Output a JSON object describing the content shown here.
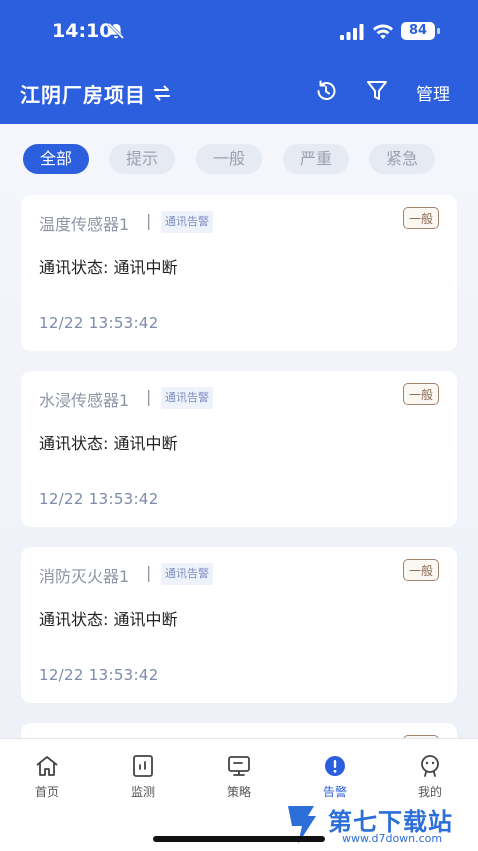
{
  "status_bar": {
    "time": "14:10",
    "battery": "84"
  },
  "header": {
    "project_title": "江阴厂房项目",
    "manage_label": "管理"
  },
  "filter_tabs": [
    {
      "label": "全部",
      "active": true
    },
    {
      "label": "提示",
      "active": false
    },
    {
      "label": "一般",
      "active": false
    },
    {
      "label": "严重",
      "active": false
    },
    {
      "label": "紧急",
      "active": false
    }
  ],
  "alarms": [
    {
      "device": "温度传感器1",
      "separator": "|",
      "type": "通讯告警",
      "level": "一般",
      "message": "通讯状态: 通讯中断",
      "time": "12/22 13:53:42"
    },
    {
      "device": "水浸传感器1",
      "separator": "|",
      "type": "通讯告警",
      "level": "一般",
      "message": "通讯状态: 通讯中断",
      "time": "12/22 13:53:42"
    },
    {
      "device": "消防灭火器1",
      "separator": "|",
      "type": "通讯告警",
      "level": "一般",
      "message": "通讯状态: 通讯中断",
      "time": "12/22 13:53:42"
    }
  ],
  "bottom_nav": [
    {
      "label": "首页",
      "icon": "home-icon",
      "active": false
    },
    {
      "label": "监测",
      "icon": "monitor-icon",
      "active": false
    },
    {
      "label": "策略",
      "icon": "strategy-icon",
      "active": false
    },
    {
      "label": "告警",
      "icon": "alarm-icon",
      "active": true
    },
    {
      "label": "我的",
      "icon": "profile-icon",
      "active": false
    }
  ],
  "watermark": {
    "title": "第七下载站",
    "url": "www.d7down.com"
  },
  "colors": {
    "primary": "#2c5fde",
    "badge_border": "#a5826c",
    "time_text": "#7d8aa8"
  }
}
